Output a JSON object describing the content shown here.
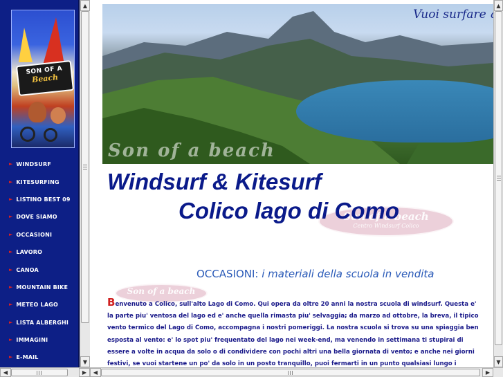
{
  "left_frame": {
    "logo": {
      "badge_line1": "SON OF A",
      "badge_line2": "Beach"
    },
    "nav_items": [
      {
        "label": "WINDSURF"
      },
      {
        "label": "KITESURFING"
      },
      {
        "label": "LISTINO BEST 09"
      },
      {
        "label": "DOVE SIAMO"
      },
      {
        "label": "OCCASIONI"
      },
      {
        "label": "LAVORO"
      },
      {
        "label": "CANOA"
      },
      {
        "label": "MOUNTAIN BIKE"
      },
      {
        "label": "METEO LAGO"
      },
      {
        "label": "LISTA ALBERGHI"
      },
      {
        "label": "IMMAGINI"
      },
      {
        "label": "E-MAIL"
      }
    ],
    "nav_arrow_icon": "arrow-right-icon",
    "arrow_color": "#e02020"
  },
  "main": {
    "hero_tagline": "Vuoi surfare q",
    "hero_watermark": "Son of a beach",
    "title_line1": "Windsurf & Kitesurf",
    "title_line2": "Colico lago di Como",
    "oval_logo": {
      "line1": "Son of a beach",
      "line2": "Centro Windsurf Colico"
    },
    "subtitle_prefix": "OCCASIONI:",
    "subtitle_rest": " i materiali della scuola in vendita",
    "intro_dropcap": "B",
    "intro_text": "envenuto a Colico, sull'alto Lago di Como. Qui opera da oltre 20 anni la nostra scuola di windsurf. Questa e' la parte piu' ventosa del lago ed e' anche quella rimasta piu' selvaggia; da marzo ad ottobre, la breva, il tipico vento termico del Lago di Como, accompagna i nostri pomeriggi. La nostra scuola si trova su una spiaggia ben esposta al vento: e' lo spot piu' frequentato del lago nei week-end, ma venendo in settimana ti stupirai di essere a volte in acqua da solo o di condividere con pochi altri una bella giornata di vento; e anche nei giorni festivi, se vuoi startene un po' da solo in un posto tranquillo, puoi fermarti in un punto qualsiasi lungo i chilometri di spiaggia selvaggia e nessuno ti disturbera'.",
    "text_color": "#1a1a8a",
    "title_color": "#0a1a8a",
    "subtitle_color": "#2a5ab8"
  },
  "scrollbars": {
    "up_icon": "arrow-up-icon",
    "down_icon": "arrow-down-icon",
    "left_icon": "arrow-left-icon",
    "right_icon": "arrow-right-icon"
  }
}
